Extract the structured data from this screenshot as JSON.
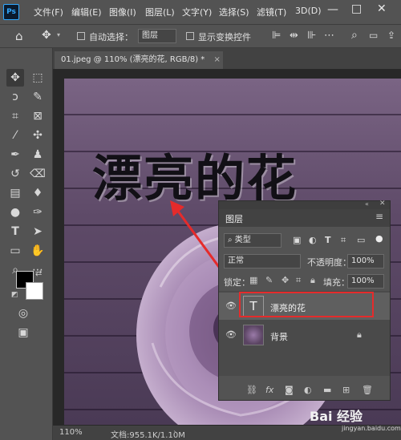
{
  "app": {
    "logo": "Ps"
  },
  "menu": [
    "文件(F)",
    "编辑(E)",
    "图像(I)",
    "图层(L)",
    "文字(Y)",
    "选择(S)",
    "滤镜(T)",
    "3D(D)"
  ],
  "options": {
    "auto_select_label": "自动选择：",
    "auto_select_value": "图层",
    "show_transform_label": "显示变换控件"
  },
  "document": {
    "tab_title": "01.jpeg @ 110% (漂亮的花, RGB/8) *",
    "headline": "漂亮的花"
  },
  "status": {
    "zoom": "110%",
    "doc_info": "文档:955.1K/1.10M"
  },
  "layers_panel": {
    "title": "图层",
    "filter_value": "类型",
    "blend_mode": "正常",
    "opacity_label": "不透明度：",
    "opacity_value": "100%",
    "lock_label": "锁定：",
    "fill_label": "填充：",
    "fill_value": "100%",
    "layers": [
      {
        "name": "漂亮的花",
        "type_glyph": "T"
      },
      {
        "name": "背景"
      }
    ]
  },
  "watermark": {
    "text": "Bai 经验",
    "sub": "jingyan.baidu.com"
  },
  "colors": {
    "highlight": "#e52b2b",
    "arrow": "#e52b2b",
    "ps_blue": "#31a8ff"
  }
}
